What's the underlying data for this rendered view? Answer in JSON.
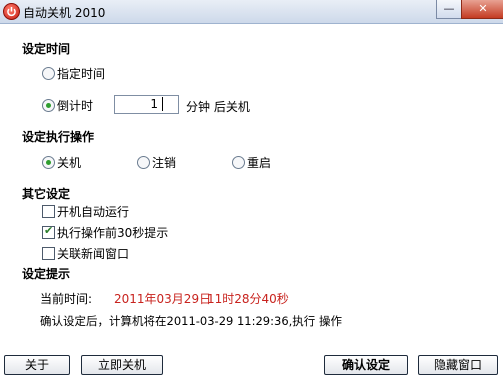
{
  "window": {
    "title": "自动关机 2010",
    "minimize_glyph": "—",
    "close_glyph": "✕"
  },
  "sections": {
    "set_time": "设定时间",
    "set_action": "设定执行操作",
    "other": "其它设定",
    "hint": "设定提示"
  },
  "time_options": {
    "specified_time": "指定时间",
    "countdown": "倒计时",
    "countdown_value": "1",
    "countdown_suffix": "分钟 后关机",
    "selected": "countdown"
  },
  "actions": {
    "shutdown": "关机",
    "logoff": "注销",
    "restart": "重启",
    "selected": "shutdown"
  },
  "other_settings": {
    "autostart": {
      "label": "开机自动运行",
      "checked": false
    },
    "remind30": {
      "label": "执行操作前30秒提示",
      "checked": true
    },
    "close_news": {
      "label": "关联新闻窗口",
      "checked": false
    }
  },
  "hint": {
    "current_time_label": "当前时间:",
    "current_date": "2011年03月29日",
    "current_clock": "11时28分40秒",
    "confirm_text": "确认设定后，计算机将在2011-03-29 11:29:36,执行  操作"
  },
  "buttons": {
    "about": "关于",
    "shutdown_now": "立即关机",
    "confirm": "确认设定",
    "hide_window": "隐藏窗口"
  },
  "colors": {
    "accent_red": "#c8231e",
    "radio_green": "#2f9e2f"
  }
}
